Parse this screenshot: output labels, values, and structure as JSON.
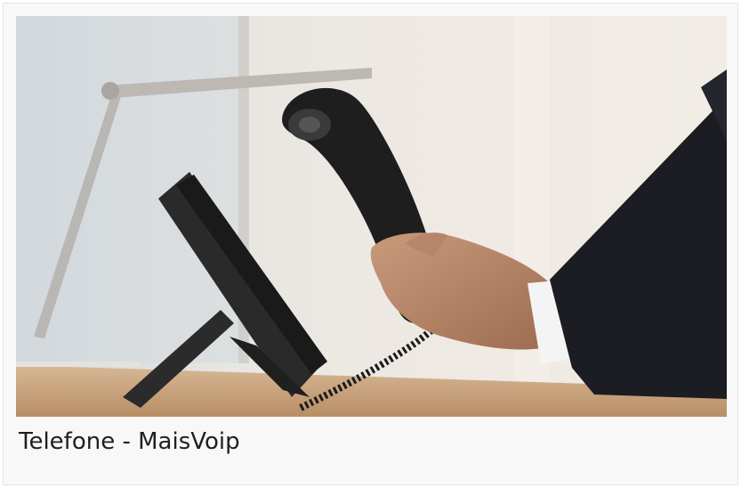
{
  "card": {
    "caption": "Telefone - MaisVoip"
  },
  "image": {
    "subject": "hand-lifting-phone-handset-photo"
  }
}
